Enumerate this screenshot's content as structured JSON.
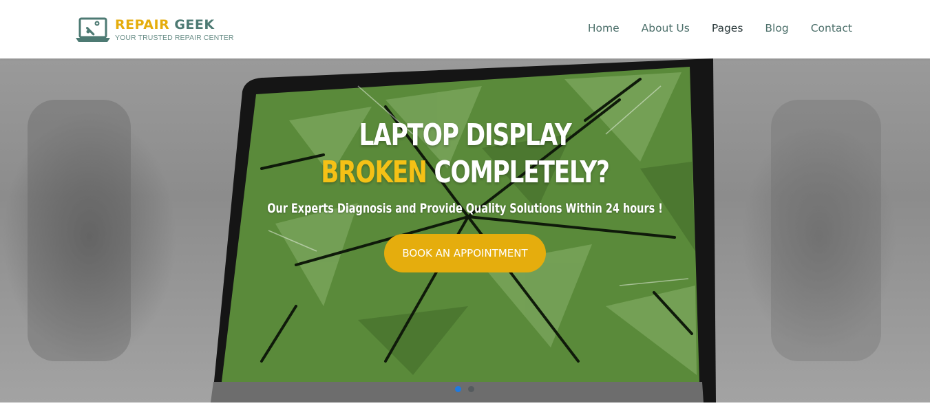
{
  "brand": {
    "name_part1": "REPAIR",
    "name_part2": "GEEK",
    "tagline": "YOUR TRUSTED REPAIR CENTER",
    "icon": "laptop-wrench-icon",
    "color_primary": "#e5ad0d",
    "color_secondary": "#4d7a73"
  },
  "nav": {
    "items": [
      {
        "label": "Home"
      },
      {
        "label": "About Us"
      },
      {
        "label": "Pages"
      },
      {
        "label": "Blog"
      },
      {
        "label": "Contact"
      }
    ],
    "active_label": "Pages"
  },
  "hero": {
    "title_line1": "LAPTOP DISPLAY",
    "title_highlight": "BROKEN",
    "title_line2_rest": "COMPLETELY?",
    "subtitle": "Our Experts Diagnosis and Provide Quality Solutions Within 24 hours !",
    "cta_label": "BOOK AN APPOINTMENT",
    "highlight_color": "#f5c116",
    "slides": [
      {
        "active": true
      },
      {
        "active": false
      }
    ]
  }
}
